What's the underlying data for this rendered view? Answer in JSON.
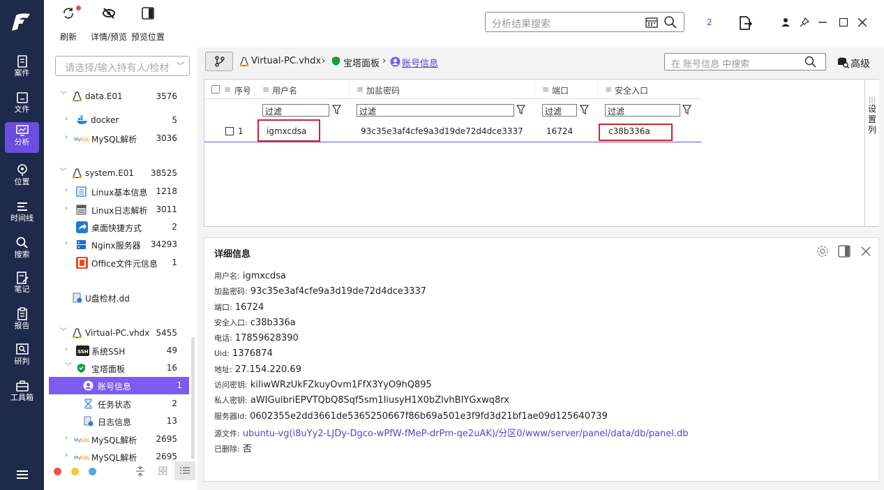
{
  "toolbar": {
    "refresh": "刷新",
    "details": "详情/预览",
    "preview_pos": "预览位置"
  },
  "top_search": {
    "placeholder": "分析结果搜索"
  },
  "top_count": "2",
  "nav": [
    {
      "label": "案件"
    },
    {
      "label": "文件"
    },
    {
      "label": "分析"
    },
    {
      "label": "位置"
    },
    {
      "label": "时间线"
    },
    {
      "label": "搜索"
    },
    {
      "label": "笔记"
    },
    {
      "label": "报告"
    },
    {
      "label": "研判"
    },
    {
      "label": "工具箱"
    }
  ],
  "left": {
    "select_placeholder": "请选择/输入持有人/检材",
    "tree": [
      {
        "label": "data.E01",
        "count": "3576"
      },
      {
        "label": "docker",
        "count": "5"
      },
      {
        "label": "MySQL解析",
        "count": "3036"
      },
      {
        "label": "system.E01",
        "count": "38525"
      },
      {
        "label": "Linux基本信息",
        "count": "1218"
      },
      {
        "label": "Linux日志解析",
        "count": "3011"
      },
      {
        "label": "桌面快捷方式",
        "count": "2"
      },
      {
        "label": "Nginx服务器",
        "count": "34293"
      },
      {
        "label": "Office文件元信息",
        "count": "1"
      },
      {
        "label": "U盘检材.dd",
        "count": ""
      },
      {
        "label": "Virtual-PC.vhdx",
        "count": "5455"
      },
      {
        "label": "系统SSH",
        "count": "49"
      },
      {
        "label": "宝塔面板",
        "count": "16"
      },
      {
        "label": "账号信息",
        "count": "1"
      },
      {
        "label": "任务状态",
        "count": "2"
      },
      {
        "label": "日志信息",
        "count": "13"
      },
      {
        "label": "MySQL解析",
        "count": "2695"
      },
      {
        "label": "MySQL解析",
        "count": "2695"
      }
    ]
  },
  "breadcrumb": {
    "vhd": "Virtual-PC.vhdx",
    "panel": "宝塔面板",
    "current": "账号信息"
  },
  "main_search": {
    "placeholder": "在 账号信息 中搜索"
  },
  "advanced": "高级",
  "table": {
    "headers": [
      "序号",
      "用户名",
      "加盐密码",
      "端口",
      "安全入口"
    ],
    "filter_label": "过滤",
    "row": {
      "index": "1",
      "username": "igmxcdsa",
      "password": "93c35e3af4cfe9a3d19de72d4dce3337",
      "port": "16724",
      "entry": "c38b336a"
    },
    "settings_col": "设置列"
  },
  "detail": {
    "title": "详细信息",
    "lines": [
      {
        "k": "用户名:",
        "v": "igmxcdsa"
      },
      {
        "k": "加盐密码:",
        "v": "93c35e3af4cfe9a3d19de72d4dce3337"
      },
      {
        "k": "端口:",
        "v": "16724"
      },
      {
        "k": "安全入口:",
        "v": "c38b336a"
      },
      {
        "k": "电话:",
        "v": "17859628390"
      },
      {
        "k": "Uid:",
        "v": "1376874"
      },
      {
        "k": "地址:",
        "v": "27.154.220.69"
      },
      {
        "k": "访问密钥:",
        "v": "kiIiwWRzUkFZkuyOvm1FfX3YyO9hQ895"
      },
      {
        "k": "私人密钥:",
        "v": "aWIGuibriEPVTQbQ8Sqf5sm1IiusyH1X0bZlvhBIYGxwq8rx"
      },
      {
        "k": "服务器Id:",
        "v": "0602355e2dd3661de5365250667f86b69a501e3f9fd3d21bf1ae09d125640739"
      },
      {
        "k": "源文件:",
        "v": "ubuntu-vg(i8uYy2-LJDy-Dgco-wPfW-fMeP-drPm-qe2uAK)/分区0/www/server/panel/data/db/panel.db"
      },
      {
        "k": "已删除:",
        "v": "否"
      }
    ]
  }
}
